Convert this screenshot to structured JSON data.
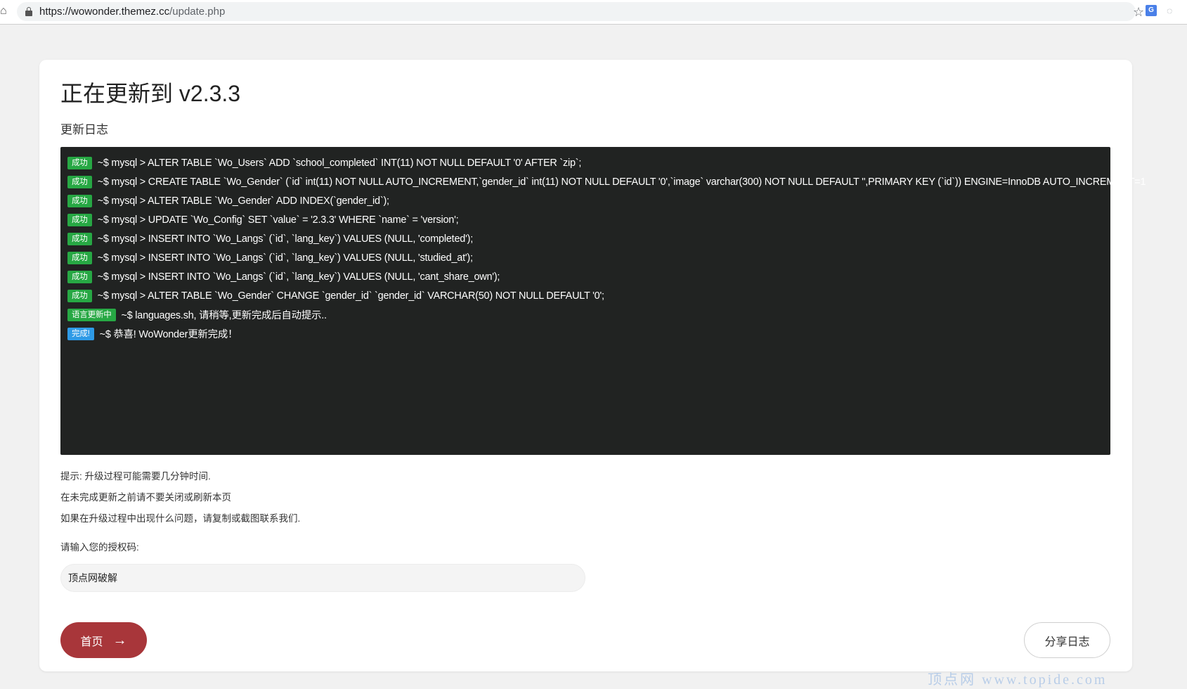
{
  "browser": {
    "url_host": "https://wowonder.themez.cc",
    "url_path": "/update.php",
    "star_icon": "star-icon",
    "extensions": [
      "translate-icon",
      "extension-icon"
    ]
  },
  "page": {
    "title": "正在更新到 v2.3.3",
    "log_label": "更新日志",
    "log": [
      {
        "badge": "成功",
        "type": "success",
        "text": "~$ mysql > ALTER TABLE `Wo_Users` ADD `school_completed` INT(11) NOT NULL DEFAULT '0' AFTER `zip`;"
      },
      {
        "badge": "成功",
        "type": "success",
        "text": "~$ mysql > CREATE TABLE `Wo_Gender` (`id` int(11) NOT NULL AUTO_INCREMENT,`gender_id` int(11) NOT NULL DEFAULT '0',`image` varchar(300) NOT NULL DEFAULT '',PRIMARY KEY (`id`)) ENGINE=InnoDB AUTO_INCREMENT=1"
      },
      {
        "badge": "成功",
        "type": "success",
        "text": "~$ mysql > ALTER TABLE `Wo_Gender` ADD INDEX(`gender_id`);"
      },
      {
        "badge": "成功",
        "type": "success",
        "text": "~$ mysql > UPDATE `Wo_Config` SET `value` = '2.3.3' WHERE `name` = 'version';"
      },
      {
        "badge": "成功",
        "type": "success",
        "text": "~$ mysql > INSERT INTO `Wo_Langs` (`id`, `lang_key`) VALUES (NULL, 'completed');"
      },
      {
        "badge": "成功",
        "type": "success",
        "text": "~$ mysql > INSERT INTO `Wo_Langs` (`id`, `lang_key`) VALUES (NULL, 'studied_at');"
      },
      {
        "badge": "成功",
        "type": "success",
        "text": "~$ mysql > INSERT INTO `Wo_Langs` (`id`, `lang_key`) VALUES (NULL, 'cant_share_own');"
      },
      {
        "badge": "成功",
        "type": "success",
        "text": "~$ mysql > ALTER TABLE `Wo_Gender` CHANGE `gender_id` `gender_id` VARCHAR(50) NOT NULL DEFAULT '0';"
      },
      {
        "badge": "语言更新中",
        "type": "success",
        "text": "~$ languages.sh, 请稍等,更新完成后自动提示.."
      },
      {
        "badge": "完成!",
        "type": "info",
        "text": "~$ 恭喜! WoWonder更新完成！"
      }
    ],
    "notes": [
      "提示: 升级过程可能需要几分钟时间.",
      "在未完成更新之前请不要关闭或刷新本页",
      "如果在升级过程中出现什么问题，请复制或截图联系我们."
    ],
    "code_label": "请输入您的授权码:",
    "code_value": "顶点网破解",
    "home_button": "首页",
    "share_button": "分享日志"
  },
  "watermark": "顶点网 www.topide.com",
  "colors": {
    "log_background": "#212322",
    "success_badge": "#27a844",
    "info_badge": "#2e9ae6",
    "home_button": "#a8363a"
  }
}
